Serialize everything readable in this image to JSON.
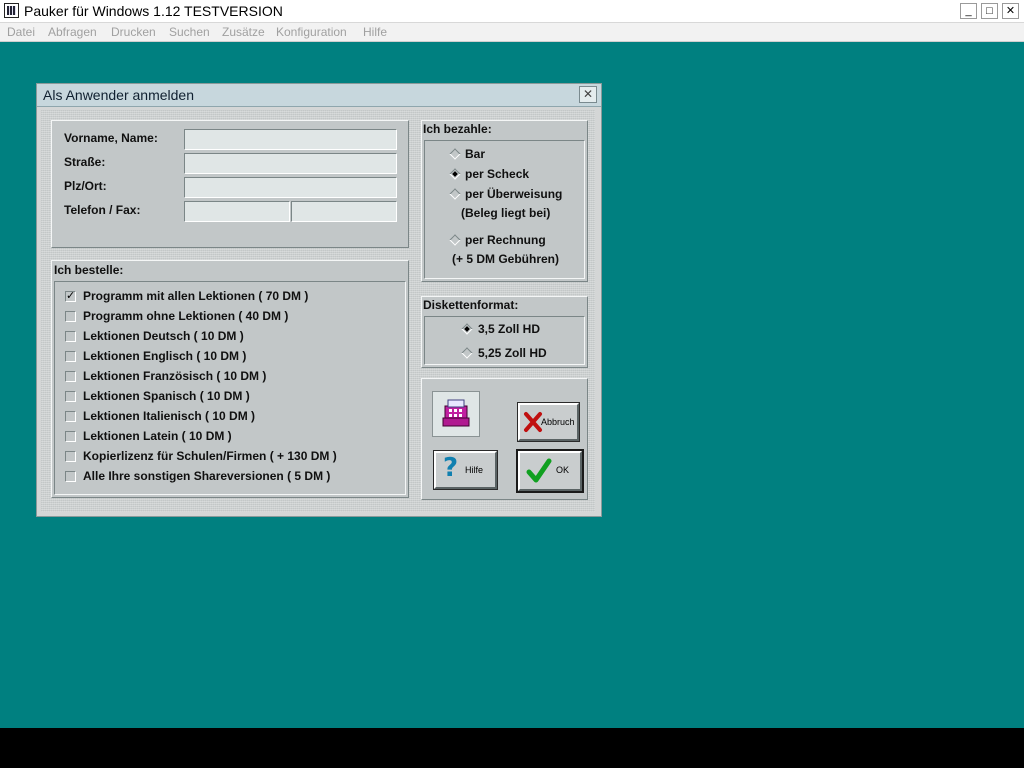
{
  "app": {
    "title": "Pauker für Windows 1.12 TESTVERSION",
    "controls": {
      "minimize": "_",
      "maximize": "□",
      "close": "✕"
    }
  },
  "menu": [
    "Datei",
    "Abfragen",
    "Drucken",
    "Suchen",
    "Zusätze",
    "Konfiguration",
    "Hilfe"
  ],
  "dialog": {
    "title": "Als Anwender anmelden",
    "close": "✕",
    "address": {
      "name_label": "Vorname, Name:",
      "street_label": "Straße:",
      "city_label": "Plz/Ort:",
      "phone_label": "Telefon / Fax:",
      "name_value": "",
      "street_value": "",
      "city_value": "",
      "phone_value": "",
      "fax_value": ""
    },
    "order": {
      "title": "Ich bestelle:",
      "items": [
        {
          "label": "Programm mit allen Lektionen ( 70 DM )",
          "checked": true
        },
        {
          "label": "Programm ohne Lektionen ( 40 DM )",
          "checked": false
        },
        {
          "label": "Lektionen Deutsch  ( 10 DM )",
          "checked": false
        },
        {
          "label": "Lektionen Englisch  ( 10 DM )",
          "checked": false
        },
        {
          "label": "Lektionen Französisch ( 10 DM )",
          "checked": false
        },
        {
          "label": "Lektionen Spanisch ( 10 DM )",
          "checked": false
        },
        {
          "label": "Lektionen Italienisch  ( 10 DM )",
          "checked": false
        },
        {
          "label": "Lektionen Latein  ( 10 DM )",
          "checked": false
        },
        {
          "label": "Kopierlizenz für Schulen/Firmen    ( + 130 DM )",
          "checked": false
        },
        {
          "label": "Alle Ihre sonstigen Shareversionen ( 5 DM )",
          "checked": false
        }
      ]
    },
    "payment": {
      "title": "Ich bezahle:",
      "options": [
        {
          "label": "Bar",
          "note": "",
          "selected": false
        },
        {
          "label": "per Scheck",
          "note": "",
          "selected": true
        },
        {
          "label": "per Überweisung",
          "note": "(Beleg liegt bei)",
          "selected": false
        },
        {
          "label": "per Rechnung",
          "note": "(+ 5 DM Gebühren)",
          "selected": false
        }
      ]
    },
    "disk": {
      "title": "Diskettenformat:",
      "options": [
        {
          "label": "3,5 Zoll HD",
          "selected": true
        },
        {
          "label": "5,25 Zoll HD",
          "selected": false
        }
      ]
    },
    "buttons": {
      "cancel": "Abbruch",
      "help": "Hilfe",
      "ok": "OK"
    },
    "colors": {
      "desktop": "#008080",
      "register_icon": "#c020a0"
    }
  }
}
